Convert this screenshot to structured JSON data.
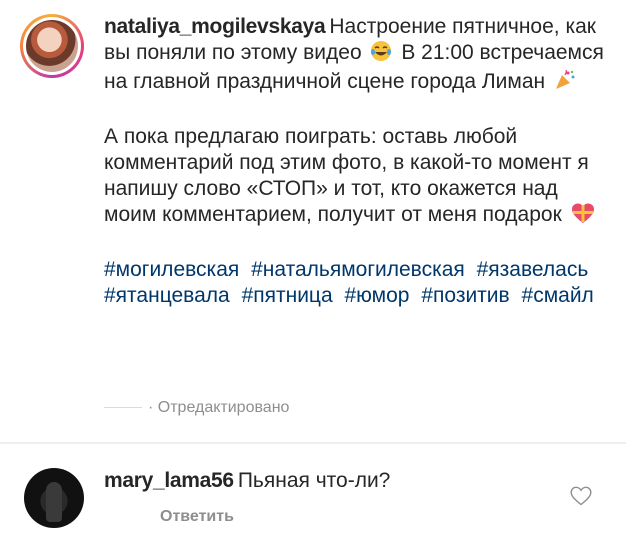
{
  "post": {
    "username": "nataliya_mogilevskaya",
    "paragraph1_text": "Настроение пятничное, как вы поняли по этому видео",
    "paragraph1_after_emoji": "В 21:00 встречаемся на главной праздничной сцене города Лиман",
    "paragraph2_text": "А пока предлагаю поиграть: оставь любой комментарий под этим фото, в какой-то момент я напишу слово «СТОП» и тот, кто окажется над моим комментарием, получит от меня подарок",
    "emoji1": "laughing-tears-emoji",
    "emoji2": "party-popper-emoji",
    "emoji3": "gift-heart-emoji",
    "hashtags": [
      "#могилевская",
      "#натальямогилевская",
      "#язавелась",
      "#ятанцевала",
      "#пятница",
      "#юмор",
      "#позитив",
      "#смайл"
    ],
    "edited_label": "· Отредактировано"
  },
  "comment": {
    "username": "mary_lama56",
    "text": "Пьяная что-ли?",
    "reply_label": "Ответить",
    "like_icon": "heart-icon"
  },
  "colors": {
    "text": "#262626",
    "hashtag": "#00376b",
    "secondary": "#8e8e8e"
  }
}
